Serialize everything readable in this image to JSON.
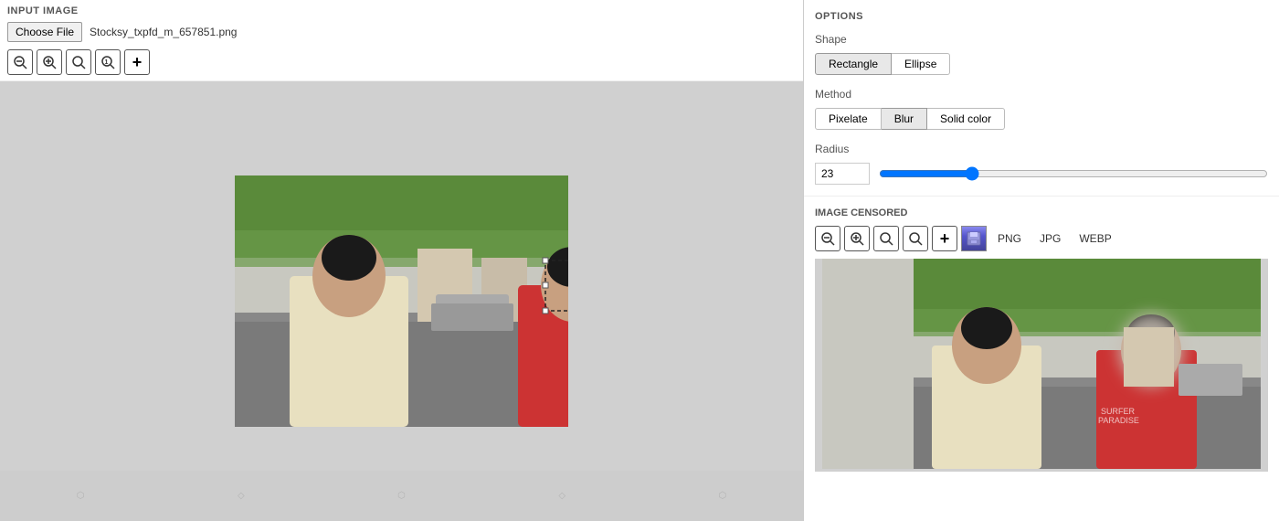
{
  "header": {
    "section_label": "INPUT IMAGE",
    "choose_file_label": "Choose File",
    "filename": "Stocksy_txpfd_m_657851.png"
  },
  "zoom_buttons": [
    {
      "id": "zoom-fit",
      "symbol": "🔍",
      "unicode": "⊖",
      "title": "Zoom fit"
    },
    {
      "id": "zoom-out",
      "symbol": "🔍",
      "unicode": "🔍",
      "title": "Zoom out"
    },
    {
      "id": "zoom-in",
      "symbol": "🔍",
      "unicode": "🔍",
      "title": "Zoom in"
    },
    {
      "id": "zoom-actual",
      "symbol": "🔍",
      "unicode": "🔍",
      "title": "Zoom actual"
    },
    {
      "id": "zoom-add",
      "symbol": "+",
      "unicode": "✛",
      "title": "Add region"
    }
  ],
  "options": {
    "section_label": "OPTIONS",
    "shape": {
      "label": "Shape",
      "buttons": [
        "Rectangle",
        "Ellipse"
      ],
      "active": "Rectangle"
    },
    "method": {
      "label": "Method",
      "buttons": [
        "Pixelate",
        "Blur",
        "Solid color"
      ],
      "active": "Blur"
    },
    "radius": {
      "label": "Radius",
      "value": 23,
      "min": 0,
      "max": 100,
      "slider_percent": 23
    }
  },
  "censored": {
    "section_label": "IMAGE CENSORED",
    "formats": [
      "PNG",
      "JPG",
      "WEBP"
    ]
  }
}
